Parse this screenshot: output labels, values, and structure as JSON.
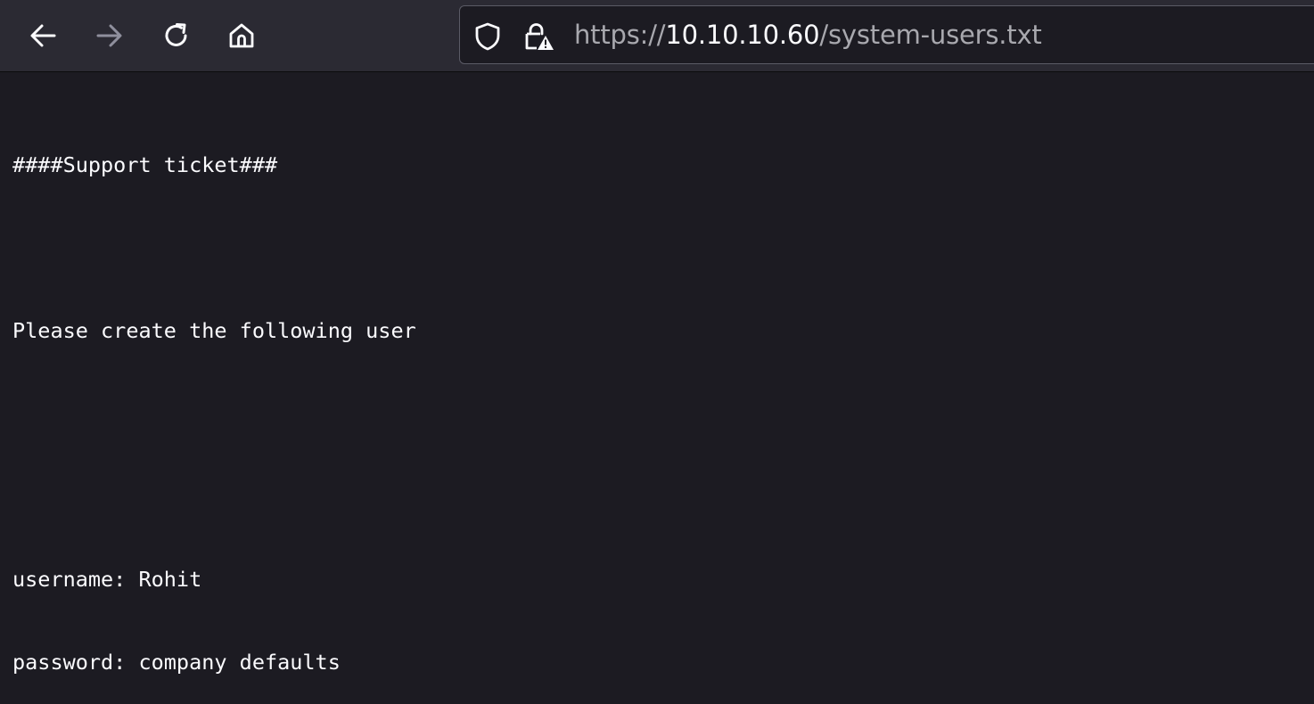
{
  "browser": {
    "toolbar": {
      "back_icon": "arrow-left-icon",
      "forward_icon": "arrow-right-icon",
      "reload_icon": "reload-icon",
      "home_icon": "home-icon"
    },
    "urlbar": {
      "tracking_icon": "shield-icon",
      "security_icon": "lock-warning-icon",
      "scheme": "https://",
      "host": "10.10.10.60",
      "path": "/system-users.txt"
    },
    "colors": {
      "toolbar_bg": "#2b2a33",
      "page_bg": "#1c1b22",
      "text": "#fbfbfe",
      "muted_text": "#a8a8ae"
    }
  },
  "document": {
    "heading": "####Support ticket###",
    "request": "Please create the following user",
    "username_line": "username: Rohit",
    "password_line": "password: company defaults"
  }
}
